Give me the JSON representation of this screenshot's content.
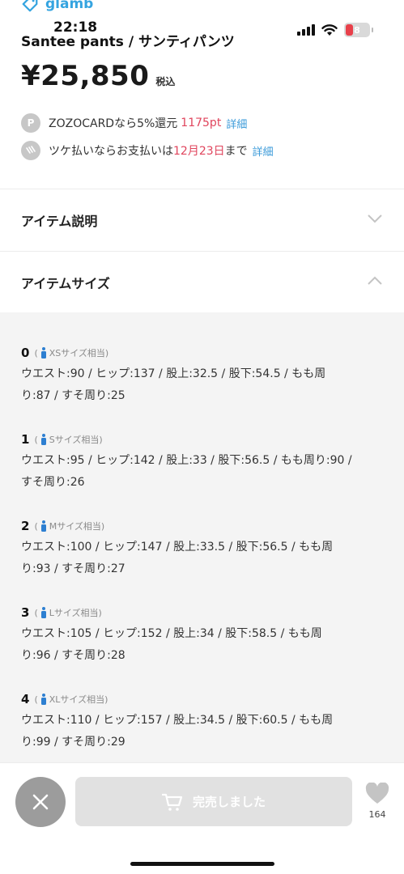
{
  "status_bar": {
    "brand": "glamb",
    "time": "22:18",
    "battery": "8"
  },
  "product": {
    "name": "Santee pants / サンティパンツ",
    "price": "¥25,850",
    "tax_label": "税込"
  },
  "points": {
    "icon_letter": "P",
    "prefix": "ZOZOCARDなら5%還元",
    "amount": "1175pt",
    "link": "詳細"
  },
  "tsuke": {
    "text_before": "ツケ払いならお支払いは",
    "date": "12月23日",
    "text_after": "まで",
    "link": "詳細"
  },
  "accordions": [
    {
      "title": "アイテム説明",
      "state": "collapsed"
    },
    {
      "title": "アイテムサイズ",
      "state": "expanded"
    }
  ],
  "sizes": [
    {
      "num": "0",
      "paren": "(",
      "equiv": "XSサイズ相当)",
      "line1": "ウエスト:90 / ヒップ:137 / 股上:32.5 / 股下:54.5 / もも周",
      "line2": "り:87 / すそ周り:25"
    },
    {
      "num": "1",
      "paren": "(",
      "equiv": "Sサイズ相当)",
      "line1": "ウエスト:95 / ヒップ:142 / 股上:33 / 股下:56.5 / もも周り:90 /",
      "line2": "すそ周り:26"
    },
    {
      "num": "2",
      "paren": "(",
      "equiv": "Mサイズ相当)",
      "line1": "ウエスト:100 / ヒップ:147 / 股上:33.5 / 股下:56.5 / もも周",
      "line2": "り:93 / すそ周り:27"
    },
    {
      "num": "3",
      "paren": "(",
      "equiv": "Lサイズ相当)",
      "line1": "ウエスト:105 / ヒップ:152 / 股上:34 / 股下:58.5 / もも周",
      "line2": "り:96 / すそ周り:28"
    },
    {
      "num": "4",
      "paren": "(",
      "equiv": "XLサイズ相当)",
      "line1": "ウエスト:110 / ヒップ:157 / 股上:34.5 / 股下:60.5 / もも周",
      "line2": "り:99 / すそ周り:29"
    }
  ],
  "bottom": {
    "soldout_label": "完売しました",
    "fav_count": "164"
  },
  "colors": {
    "accent_red": "#e0455d",
    "link_blue": "#3a9ad9",
    "brand_blue": "#35a4e0"
  }
}
